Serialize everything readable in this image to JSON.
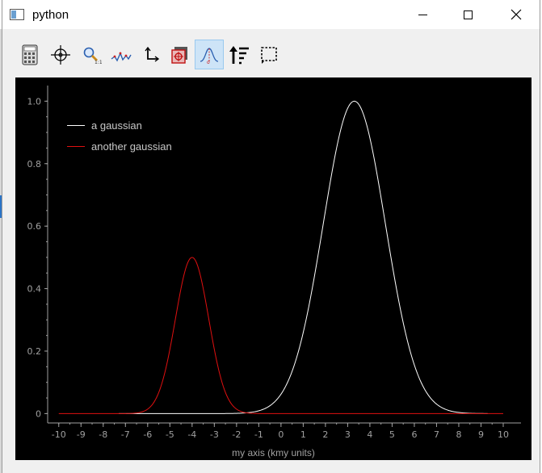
{
  "window": {
    "title": "python",
    "app_icon": "python-window-icon",
    "controls": [
      "minimize-icon",
      "maximize-icon",
      "close-icon"
    ]
  },
  "toolbar": {
    "tools": [
      {
        "name": "calculator-tool",
        "icon": "calculator-icon",
        "active": false
      },
      {
        "name": "crosshair-tool",
        "icon": "crosshair-icon",
        "active": false
      },
      {
        "name": "zoom-tool",
        "icon": "magnifier-icon",
        "active": false
      },
      {
        "name": "peaks-tool",
        "icon": "peaks-icon",
        "active": false
      },
      {
        "name": "axes-tool",
        "icon": "axes-icon",
        "active": false
      },
      {
        "name": "snapshot-tool",
        "icon": "target-square-icon",
        "active": false
      },
      {
        "name": "gaussian-fit-tool",
        "icon": "gaussian-fit-icon",
        "active": true
      },
      {
        "name": "sort-tool",
        "icon": "sort-arrow-icon",
        "active": false
      },
      {
        "name": "roi-select-tool",
        "icon": "dashed-select-icon",
        "active": false
      }
    ]
  },
  "colors": {
    "plot_background": "#000000",
    "series_white": "#ffffff",
    "series_red": "#e01010",
    "axis_text": "#a0a0a0"
  },
  "chart_data": {
    "type": "line",
    "title": "",
    "xlabel": "my axis (kmy units)",
    "ylabel": "",
    "xlim": [
      -10.5,
      10.8
    ],
    "ylim": [
      -0.03,
      1.05
    ],
    "xticks": [
      -10,
      -9,
      -8,
      -7,
      -6,
      -5,
      -4,
      -3,
      -2,
      -1,
      0,
      1,
      2,
      3,
      4,
      5,
      6,
      7,
      8,
      9,
      10
    ],
    "yticks": [
      0,
      0.2,
      0.4,
      0.6,
      0.8,
      1.0
    ],
    "ytick_labels": [
      "0",
      "0.2",
      "0.4",
      "0.6",
      "0.8",
      "1.0"
    ],
    "grid": false,
    "legend_position": "top-left",
    "series": [
      {
        "name": "a gaussian",
        "color": "#ffffff",
        "x_start": -7.3,
        "x_end": 9.3,
        "amplitude": 1.0,
        "center": 3.3,
        "sigma": 1.4
      },
      {
        "name": "another gaussian",
        "color": "#e01010",
        "x_start": -10,
        "x_end": 10,
        "amplitude": 0.5,
        "center": -4.0,
        "sigma": 0.75
      }
    ]
  }
}
